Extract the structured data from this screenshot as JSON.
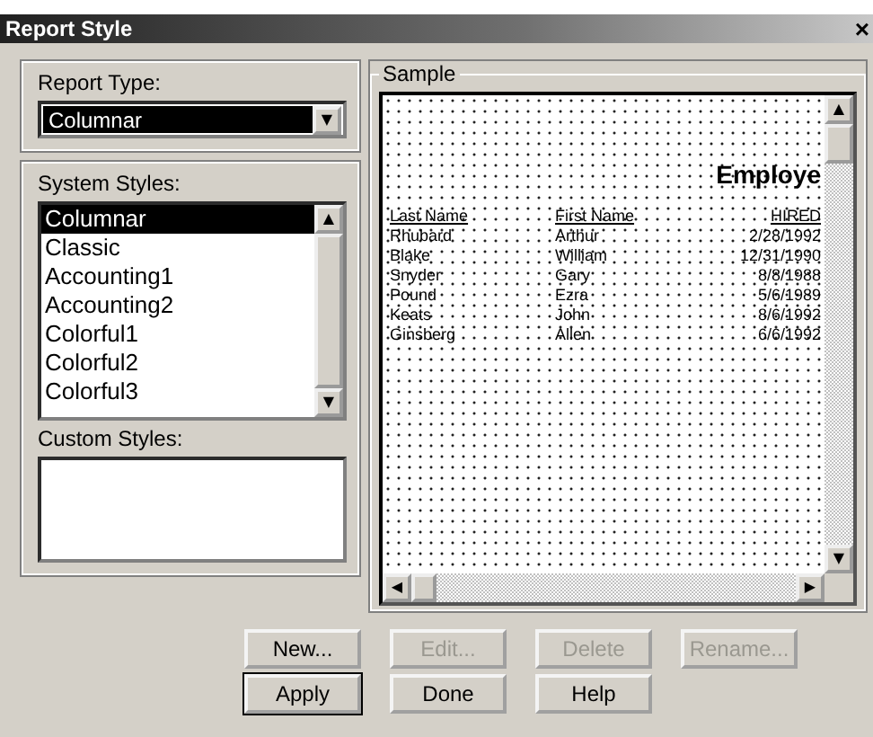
{
  "window": {
    "title": "Report Style",
    "close": "×"
  },
  "report_type": {
    "label": "Report Type:",
    "value": "Columnar",
    "arrow": "▼"
  },
  "system_styles": {
    "label": "System Styles:",
    "items": [
      {
        "label": "Columnar",
        "selected": true
      },
      {
        "label": "Classic",
        "selected": false
      },
      {
        "label": "Accounting1",
        "selected": false
      },
      {
        "label": "Accounting2",
        "selected": false
      },
      {
        "label": "Colorful1",
        "selected": false
      },
      {
        "label": "Colorful2",
        "selected": false
      },
      {
        "label": "Colorful3",
        "selected": false
      }
    ],
    "up": "▲",
    "down": "▼"
  },
  "custom_styles": {
    "label": "Custom Styles:"
  },
  "sample": {
    "label": "Sample",
    "title": "Employe",
    "columns": [
      "Last Name",
      "First Name",
      "HIRED"
    ],
    "rows": [
      [
        "Rhubard",
        "Arthur",
        "2/28/1992"
      ],
      [
        "Blake",
        "William",
        "12/31/1990"
      ],
      [
        "Snyder",
        "Gary",
        "8/8/1988"
      ],
      [
        "Pound",
        "Ezra",
        "5/6/1989"
      ],
      [
        "Keats",
        "John",
        "8/6/1992"
      ],
      [
        "Ginsberg",
        "Allen",
        "6/6/1992"
      ]
    ],
    "up": "▲",
    "down": "▼",
    "left": "◀",
    "right": "▶"
  },
  "buttons": [
    {
      "label": "New...",
      "disabled": false
    },
    {
      "label": "Edit...",
      "disabled": true
    },
    {
      "label": "Delete",
      "disabled": true
    },
    {
      "label": "Rename...",
      "disabled": true
    },
    {
      "label": "Apply",
      "disabled": false,
      "default": true
    },
    {
      "label": "Done",
      "disabled": false,
      "default": false
    },
    {
      "label": "Help",
      "disabled": false,
      "default": false
    }
  ]
}
